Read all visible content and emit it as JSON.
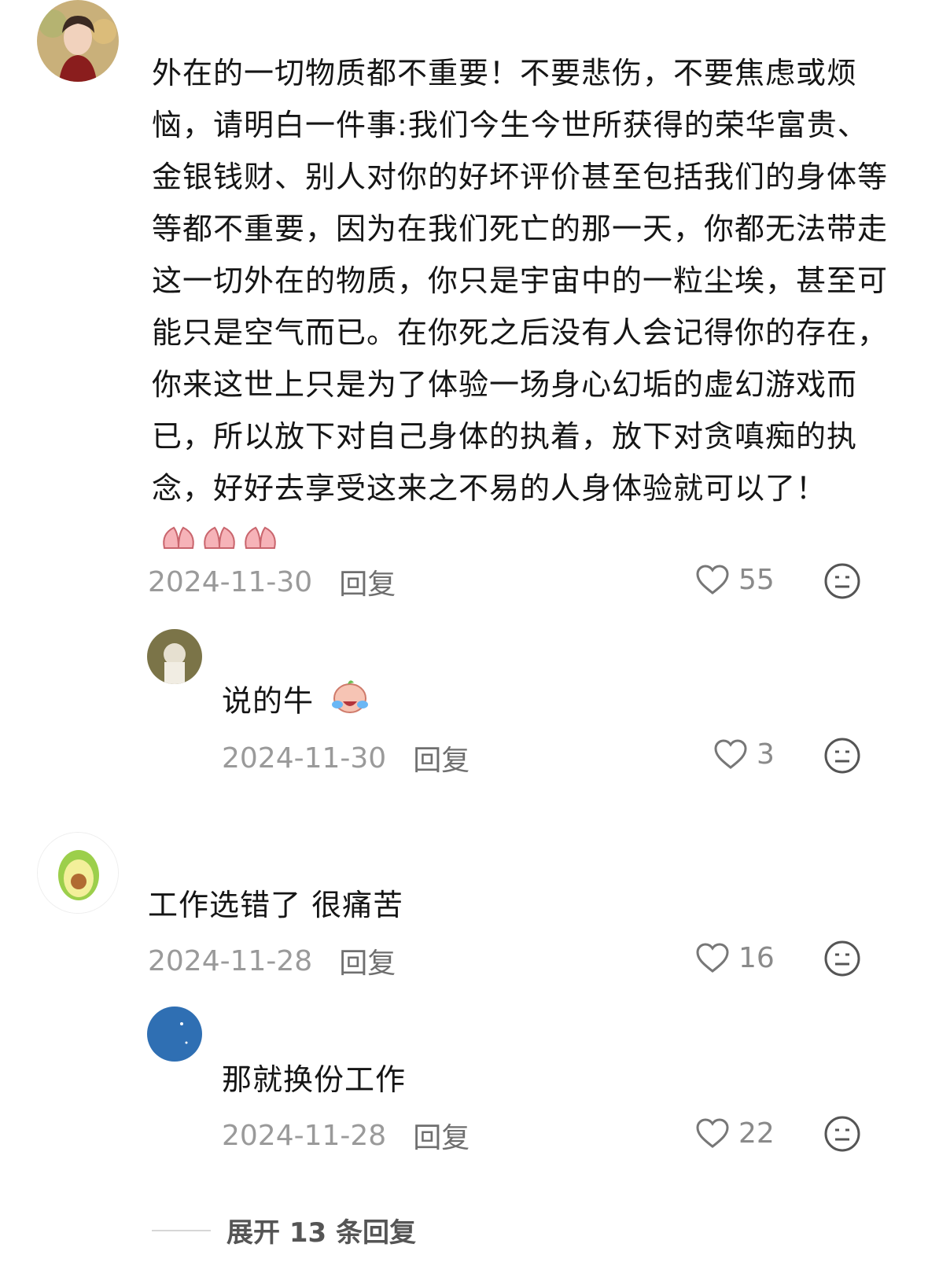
{
  "comments": [
    {
      "text": "外在的一切物质都不重要！不要悲伤，不要焦虑或烦恼，请明白一件事:我们今生今世所获得的荣华富贵、金银钱财、别人对你的好坏评价甚至包括我们的身体等等都不重要，因为在我们死亡的那一天，你都无法带走这一切外在的物质，你只是宇宙中的一粒尘埃，甚至可能只是空气而已。在你死之后没有人会记得你的存在，你来这世上只是为了体验一场身心幻垢的虚幻游戏而已，所以放下对自己身体的执着，放下对贪嗔痴的执念，好好去享受这来之不易的人身体验就可以了！",
      "emoji": "pray-hands-emoji x3",
      "date": "2024-11-30",
      "reply_label": "回复",
      "likes": "55"
    },
    {
      "text": "说的牛",
      "emoji": "crying-laughing-emoji",
      "date": "2024-11-30",
      "reply_label": "回复",
      "likes": "3"
    },
    {
      "text": "工作选错了 很痛苦",
      "date": "2024-11-28",
      "reply_label": "回复",
      "likes": "16"
    },
    {
      "text": "那就换份工作",
      "date": "2024-11-28",
      "reply_label": "回复",
      "likes": "22"
    }
  ],
  "expand_replies": "展开 13 条回复",
  "colors": {
    "text": "#151515",
    "meta": "#9a9a9a",
    "icon": "#8a8a8a",
    "avocado": "#9ccf4b",
    "blue_avatar": "#2f6fb3"
  }
}
